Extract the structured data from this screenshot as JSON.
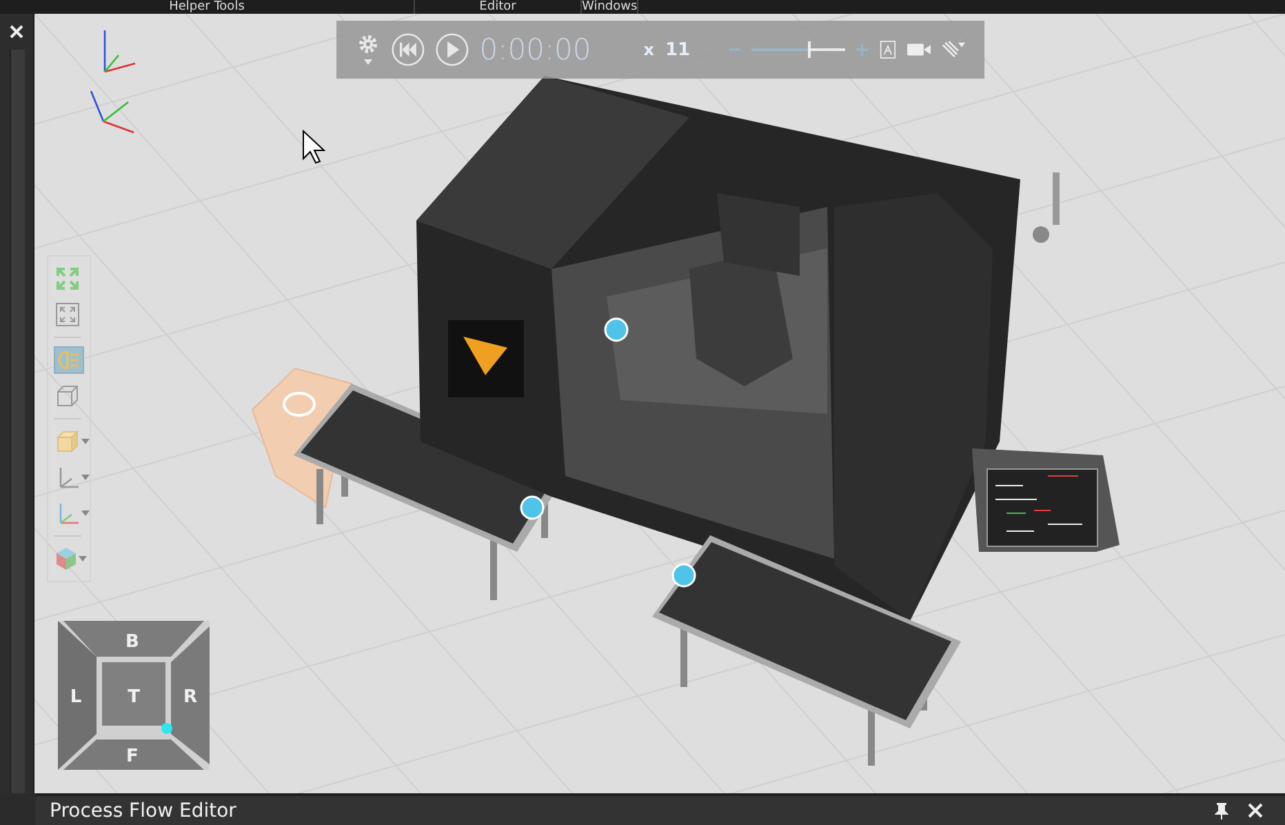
{
  "menu": [
    {
      "label": "Helper Tools"
    },
    {
      "label": "Editor"
    },
    {
      "label": "Windows"
    }
  ],
  "playback": {
    "time": "0:00:00",
    "speed_prefix": "x",
    "speed": "11",
    "zoom": {
      "level": 0.62
    }
  },
  "view_toolbar": [
    {
      "kind": "fit-selection",
      "selected": false,
      "dropdown": false
    },
    {
      "kind": "fit-all",
      "selected": false,
      "dropdown": false
    },
    {
      "kind": "headlight",
      "selected": true,
      "dropdown": false
    },
    {
      "kind": "wire-box",
      "selected": false,
      "dropdown": false
    },
    {
      "kind": "solid-box",
      "selected": false,
      "dropdown": true
    },
    {
      "kind": "axes",
      "selected": false,
      "dropdown": true
    },
    {
      "kind": "color-axes",
      "selected": false,
      "dropdown": true
    },
    {
      "kind": "color-cube",
      "selected": false,
      "dropdown": true
    }
  ],
  "view_cube": {
    "back": "B",
    "left": "L",
    "top": "T",
    "right": "R",
    "front": "F"
  },
  "panel": {
    "title": "Process Flow Editor"
  }
}
